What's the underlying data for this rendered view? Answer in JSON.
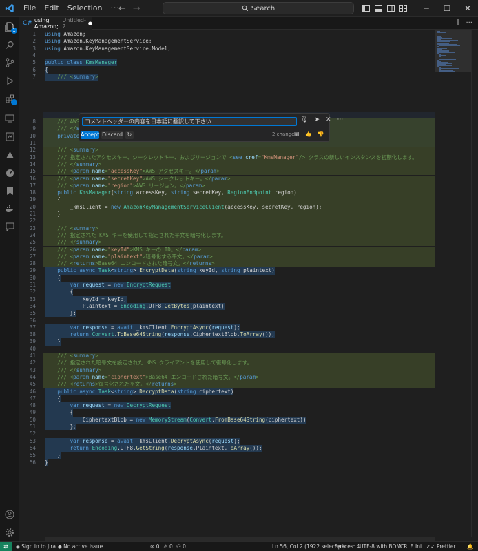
{
  "menu": {
    "items": [
      "File",
      "Edit",
      "Selection"
    ],
    "more": "···"
  },
  "search": {
    "label": "Search"
  },
  "tab": {
    "title": "using Amazon;",
    "subtitle": "Untitled-2",
    "dirty_marker": "●"
  },
  "inline_chat": {
    "prompt": "コメントヘッダーの内容を日本語に翻訳して下さい",
    "accept_label": "Accept",
    "discard_label": "Discard",
    "changes_label": "2 changes"
  },
  "status": {
    "jira": "Sign in to Jira",
    "issue": "No active issue",
    "errors": "0",
    "warnings": "0",
    "ports": "0",
    "position": "Ln 56, Col 2 (1922 selected)",
    "spaces": "Spaces: 4",
    "encoding": "UTF-8 with BOM",
    "eol": "CRLF",
    "language": "Ini",
    "prettier": "Prettier"
  },
  "activity_badge": "1",
  "colors": {
    "accent": "#0078d4",
    "remote": "#16825d",
    "highlight": "#4b5a2e"
  },
  "code_lines": [
    {
      "n": "1",
      "t": "using Amazon;"
    },
    {
      "n": "2",
      "t": "using Amazon.KeyManagementService;"
    },
    {
      "n": "3",
      "t": "using Amazon.KeyManagementService.Model;"
    },
    {
      "n": "4",
      "t": ""
    },
    {
      "n": "5",
      "t": "public class KmsManager"
    },
    {
      "n": "6",
      "t": "{"
    },
    {
      "n": "7",
      "t": "    /// <summary>"
    },
    {
      "n": "8",
      "t": "    /// AWS Key Management Service (KMS) との対話のためのマネージャーを表します。"
    },
    {
      "n": "9",
      "t": "    /// </summary>"
    },
    {
      "n": "10",
      "t": "    private readonly IAmazonKeyManagementService _kmsClient;"
    },
    {
      "n": "11",
      "t": ""
    },
    {
      "n": "12",
      "t": "    /// <summary>"
    },
    {
      "n": "13",
      "t": "    /// 指定されたアクセスキー、シークレットキー、およびリージョンで <see cref=\"KmsManager\"/> クラスの新しいインスタンスを初期化します。"
    },
    {
      "n": "14",
      "t": "    /// </summary>"
    },
    {
      "n": "15",
      "t": "    /// <param name=\"accessKey\">AWS アクセスキー。</param>"
    },
    {
      "n": "16",
      "t": "    /// <param name=\"secretKey\">AWS シークレットキー。</param>"
    },
    {
      "n": "17",
      "t": "    /// <param name=\"region\">AWS リージョン。</param>"
    },
    {
      "n": "18",
      "t": "    public KmsManager(string accessKey, string secretKey, RegionEndpoint region)"
    },
    {
      "n": "19",
      "t": "    {"
    },
    {
      "n": "20",
      "t": "        _kmsClient = new AmazonKeyManagementServiceClient(accessKey, secretKey, region);"
    },
    {
      "n": "21",
      "t": "    }"
    },
    {
      "n": "22",
      "t": ""
    },
    {
      "n": "23",
      "t": "    /// <summary>"
    },
    {
      "n": "24",
      "t": "    /// 指定された KMS キーを使用して指定された平文を暗号化します。"
    },
    {
      "n": "25",
      "t": "    /// </summary>"
    },
    {
      "n": "26",
      "t": "    /// <param name=\"keyId\">KMS キーの ID。</param>"
    },
    {
      "n": "27",
      "t": "    /// <param name=\"plaintext\">暗号化する平文。</param>"
    },
    {
      "n": "28",
      "t": "    /// <returns>Base64 エンコードされた暗号文。</returns>"
    },
    {
      "n": "29",
      "t": "    public async Task<string> EncryptData(string keyId, string plaintext)"
    },
    {
      "n": "30",
      "t": "    {"
    },
    {
      "n": "31",
      "t": "        var request = new EncryptRequest"
    },
    {
      "n": "32",
      "t": "        {"
    },
    {
      "n": "33",
      "t": "            KeyId = keyId,"
    },
    {
      "n": "34",
      "t": "            Plaintext = Encoding.UTF8.GetBytes(plaintext)"
    },
    {
      "n": "35",
      "t": "        };"
    },
    {
      "n": "36",
      "t": ""
    },
    {
      "n": "37",
      "t": "        var response = await _kmsClient.EncryptAsync(request);"
    },
    {
      "n": "38",
      "t": "        return Convert.ToBase64String(response.CiphertextBlob.ToArray());"
    },
    {
      "n": "39",
      "t": "    }"
    },
    {
      "n": "40",
      "t": ""
    },
    {
      "n": "41",
      "t": "    /// <summary>"
    },
    {
      "n": "42",
      "t": "    /// 指定された暗号文を設定された KMS クライアントを使用して復号化します。"
    },
    {
      "n": "43",
      "t": "    /// </summary>"
    },
    {
      "n": "44",
      "t": "    /// <param name=\"ciphertext\">Base64 エンコードされた暗号文。</param>"
    },
    {
      "n": "45",
      "t": "    /// <returns>復号化された平文。</returns>"
    },
    {
      "n": "46",
      "t": "    public async Task<string> DecryptData(string ciphertext)"
    },
    {
      "n": "47",
      "t": "    {"
    },
    {
      "n": "48",
      "t": "        var request = new DecryptRequest"
    },
    {
      "n": "49",
      "t": "        {"
    },
    {
      "n": "50",
      "t": "            CiphertextBlob = new MemoryStream(Convert.FromBase64String(ciphertext))"
    },
    {
      "n": "51",
      "t": "        };"
    },
    {
      "n": "52",
      "t": ""
    },
    {
      "n": "53",
      "t": "        var response = await _kmsClient.DecryptAsync(request);"
    },
    {
      "n": "54",
      "t": "        return Encoding.UTF8.GetString(response.Plaintext.ToArray());"
    },
    {
      "n": "55",
      "t": "    }"
    },
    {
      "n": "56",
      "t": "}"
    }
  ]
}
